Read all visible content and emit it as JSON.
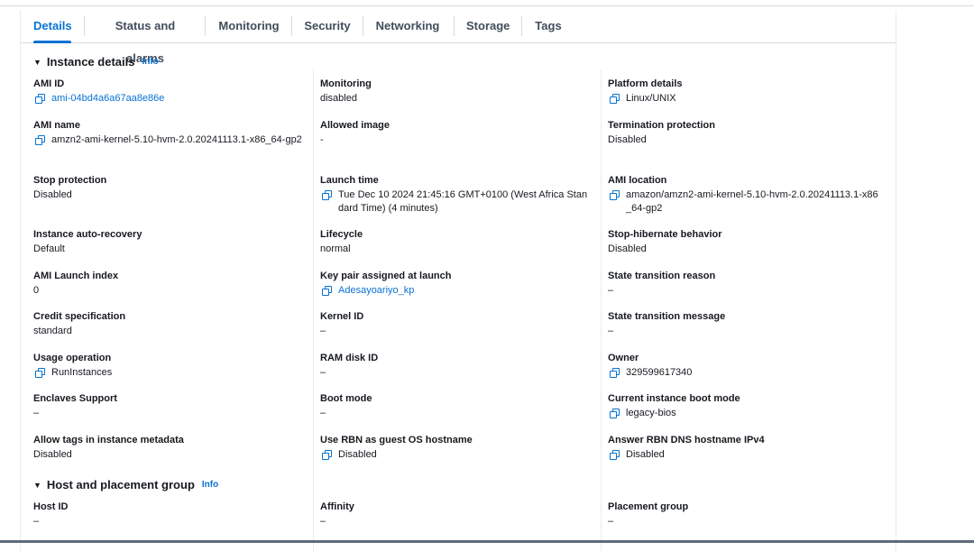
{
  "tabs": [
    "Details",
    "Status and alarms",
    "Monitoring",
    "Security",
    "Networking",
    "Storage",
    "Tags"
  ],
  "active_tab": "Details",
  "instance_details": {
    "title": "Instance details",
    "info": "Info",
    "fields": {
      "ami_id": {
        "label": "AMI ID",
        "value": "ami-04bd4a6a67aa8e86e"
      },
      "monitoring": {
        "label": "Monitoring",
        "value": "disabled"
      },
      "platform_details": {
        "label": "Platform details",
        "value": "Linux/UNIX"
      },
      "ami_name": {
        "label": "AMI name",
        "value": "amzn2-ami-kernel-5.10-hvm-2.0.20241113.1-x86_64-gp2"
      },
      "allowed_image": {
        "label": "Allowed image",
        "value": "-"
      },
      "termination_protection": {
        "label": "Termination protection",
        "value": "Disabled"
      },
      "stop_protection": {
        "label": "Stop protection",
        "value": "Disabled"
      },
      "launch_time": {
        "label": "Launch time",
        "value": "Tue Dec 10 2024 21:45:16 GMT+0100 (West Africa Standard Time) (4 minutes)"
      },
      "ami_location": {
        "label": "AMI location",
        "value": "amazon/amzn2-ami-kernel-5.10-hvm-2.0.20241113.1-x86_64-gp2"
      },
      "auto_recovery": {
        "label": "Instance auto-recovery",
        "value": "Default"
      },
      "lifecycle": {
        "label": "Lifecycle",
        "value": "normal"
      },
      "stop_hibernate": {
        "label": "Stop-hibernate behavior",
        "value": "Disabled"
      },
      "ami_launch_index": {
        "label": "AMI Launch index",
        "value": "0"
      },
      "key_pair": {
        "label": "Key pair assigned at launch",
        "value": "Adesayoariyo_kp"
      },
      "state_reason": {
        "label": "State transition reason",
        "value": "–"
      },
      "credit_spec": {
        "label": "Credit specification",
        "value": "standard"
      },
      "kernel_id": {
        "label": "Kernel ID",
        "value": "–"
      },
      "state_message": {
        "label": "State transition message",
        "value": "–"
      },
      "usage_operation": {
        "label": "Usage operation",
        "value": "RunInstances"
      },
      "ram_disk_id": {
        "label": "RAM disk ID",
        "value": "–"
      },
      "owner": {
        "label": "Owner",
        "value": "329599617340"
      },
      "enclaves": {
        "label": "Enclaves Support",
        "value": "–"
      },
      "boot_mode": {
        "label": "Boot mode",
        "value": "–"
      },
      "current_boot_mode": {
        "label": "Current instance boot mode",
        "value": "legacy-bios"
      },
      "allow_tags": {
        "label": "Allow tags in instance metadata",
        "value": "Disabled"
      },
      "use_rbn": {
        "label": "Use RBN as guest OS hostname",
        "value": "Disabled"
      },
      "answer_rbn": {
        "label": "Answer RBN DNS hostname IPv4",
        "value": "Disabled"
      }
    }
  },
  "host_placement": {
    "title": "Host and placement group",
    "info": "Info",
    "fields": {
      "host_id": {
        "label": "Host ID",
        "value": "–"
      },
      "affinity": {
        "label": "Affinity",
        "value": "–"
      },
      "placement_group": {
        "label": "Placement group",
        "value": "–"
      }
    }
  },
  "colors": {
    "accent": "#0972d3",
    "text": "#16191f",
    "border": "#d5dbdb"
  },
  "icons": {
    "copy": "copy-icon",
    "expand": "caret-down-icon"
  }
}
